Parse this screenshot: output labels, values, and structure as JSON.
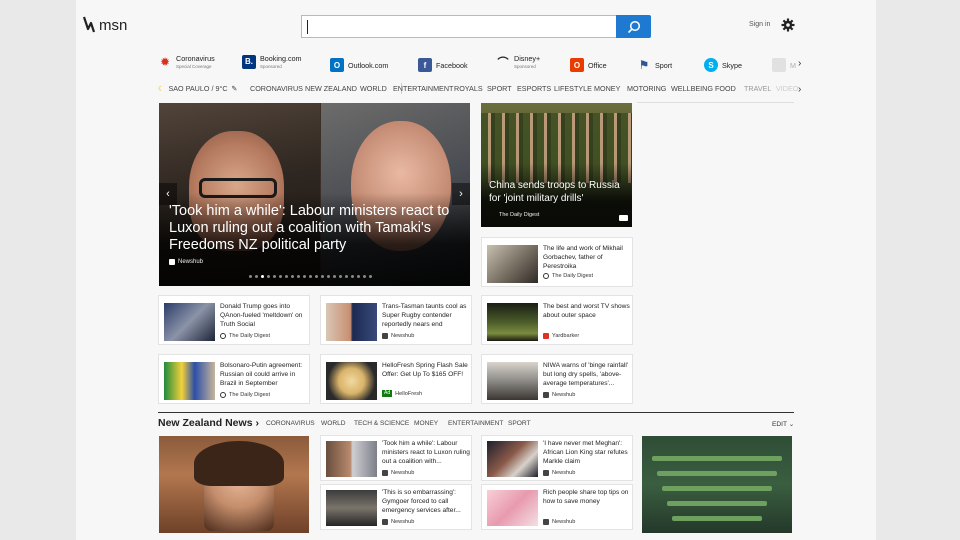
{
  "brand": {
    "logo_text": "msn"
  },
  "header": {
    "sign_in": "Sign in",
    "search_placeholder": ""
  },
  "quick_links": [
    {
      "label": "Coronavirus",
      "sub": "Special Coverage",
      "icon": "virus-icon",
      "color": "#d6311d"
    },
    {
      "label": "Booking.com",
      "sub": "Sponsored",
      "icon": "booking-icon",
      "color": "#003580"
    },
    {
      "label": "Outlook.com",
      "sub": "",
      "icon": "outlook-icon",
      "color": "#0072c6"
    },
    {
      "label": "Facebook",
      "sub": "",
      "icon": "facebook-icon",
      "color": "#3b5998"
    },
    {
      "label": "Disney+",
      "sub": "Sponsored",
      "icon": "disney-icon",
      "color": "#222222"
    },
    {
      "label": "Office",
      "sub": "",
      "icon": "office-icon",
      "color": "#eb3c00"
    },
    {
      "label": "Sport",
      "sub": "",
      "icon": "sport-icon",
      "color": "#2b5797"
    },
    {
      "label": "Skype",
      "sub": "",
      "icon": "skype-icon",
      "color": "#00aff0"
    },
    {
      "label": "M",
      "sub": "",
      "icon": "faded-icon",
      "color": "#cccccc"
    }
  ],
  "nav": {
    "weather": "SAO PAULO / 9°C",
    "items": [
      "CORONAVIRUS",
      "NEW ZEALAND",
      "WORLD",
      "ENTERTAINMENT",
      "ROYALS",
      "SPORT",
      "ESPORTS",
      "LIFESTYLE",
      "MONEY",
      "MOTORING",
      "WELLBEING",
      "FOOD",
      "TRAVEL",
      "VIDEO"
    ]
  },
  "hero": {
    "title": "'Took him a while': Labour ministers react to Luxon ruling out a coalition with Tamaki's Freedoms NZ political party",
    "source": "Newshub"
  },
  "feature": {
    "title": "China sends troops to Russia for 'joint military drills'",
    "source": "The Daily Digest"
  },
  "cards": [
    {
      "title": "The life and work of Mikhail Gorbachev, father of Perestroika",
      "source": "The Daily Digest"
    },
    {
      "title": "Donald Trump goes into QAnon-fueled 'meltdown' on Truth Social",
      "source": "The Daily Digest"
    },
    {
      "title": "Trans-Tasman taunts cool as Super Rugby contender reportedly nears end",
      "source": "Newshub"
    },
    {
      "title": "The best and worst TV shows about outer space",
      "source": "Yardbarker"
    },
    {
      "title": "Bolsonaro-Putin agreement: Russian oil could arrive in Brazil in September",
      "source": "The Daily Digest"
    },
    {
      "title": "HelloFresh Spring Flash Sale Offer: Get Up To $165 OFF!",
      "source": "HelloFresh",
      "ad": "Ad"
    },
    {
      "title": "NIWA warns of 'binge rainfall' but long dry spells, 'above-average temperatures'...",
      "source": "Newshub"
    }
  ],
  "nz": {
    "title": "New Zealand News",
    "nav": [
      "CORONAVIRUS",
      "WORLD",
      "TECH & SCIENCE",
      "MONEY",
      "ENTERTAINMENT",
      "SPORT"
    ],
    "edit": "EDIT",
    "cards": [
      {
        "title": "'Took him a while': Labour ministers react to Luxon ruling out a coalition with...",
        "source": "Newshub"
      },
      {
        "title": "'I have never met Meghan': African Lion King star refutes Markle claim",
        "source": "Newshub"
      },
      {
        "title": "'This is so embarrassing': Gymgoer forced to call emergency services after...",
        "source": "Newshub"
      },
      {
        "title": "Rich people share top tips on how to save money",
        "source": "Newshub"
      }
    ]
  }
}
